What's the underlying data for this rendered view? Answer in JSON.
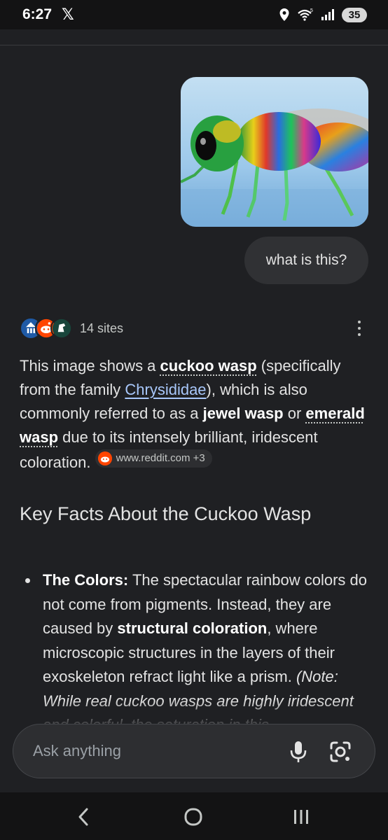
{
  "status_bar": {
    "time": "6:27",
    "x_logo": "𝕏",
    "battery": "35",
    "icons": [
      "location-icon",
      "wifi-icon",
      "signal-icon",
      "battery-icon"
    ]
  },
  "conversation": {
    "user_message": "what is this?",
    "user_image_subject": "cuckoo-wasp-photo"
  },
  "sources": {
    "label": "14 sites"
  },
  "answer": {
    "p1": "This image shows a ",
    "term_cuckoo": "cuckoo wasp",
    "p2": " (specifically from the family ",
    "term_family": "Chrysididae",
    "p3": "), which is also commonly referred to as a ",
    "term_jewel": "jewel wasp",
    "p4": " or ",
    "term_emerald": "emerald wasp",
    "p5": " due to its intensely brilliant, iridescent coloration. ",
    "citation": "www.reddit.com +3"
  },
  "section": {
    "heading": "Key Facts About the Cuckoo Wasp",
    "bullet_label": "The Colors:",
    "bullet_t1": " The spectacular rainbow colors do not come from pigments. Instead, they are caused by ",
    "bullet_bold": "structural coloration",
    "bullet_t2": ", where microscopic structures in the layers of their exoskeleton refract light like a prism. ",
    "bullet_note": "(Note: While real cuckoo wasps are highly iridescent and colorful, the saturation in this"
  },
  "input": {
    "placeholder": "Ask anything"
  },
  "colors": {
    "background": "#1f2023",
    "link": "#a8c7fa",
    "bubble": "#303134"
  }
}
